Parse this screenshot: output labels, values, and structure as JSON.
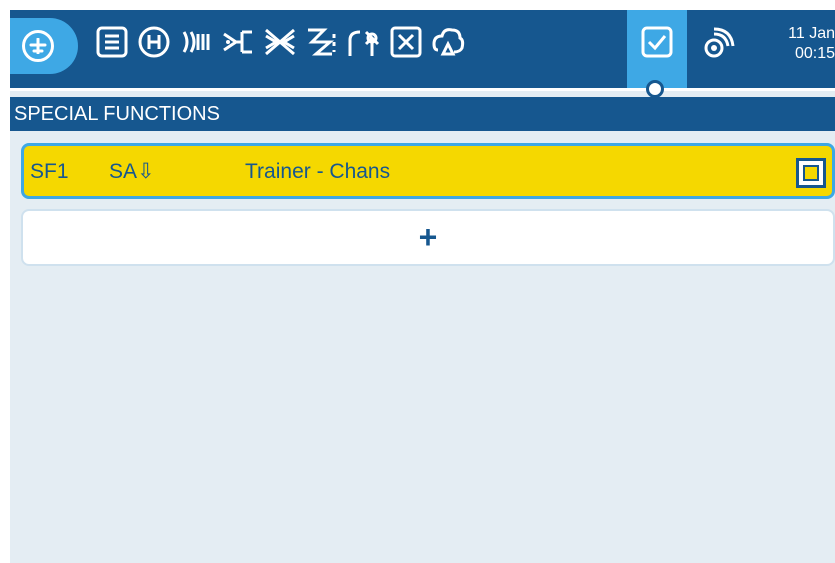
{
  "header": {
    "date": "11 Jan",
    "time": "00:15"
  },
  "tabs": [
    {
      "name": "model-setup-tab",
      "icon": "list-icon"
    },
    {
      "name": "heli-tab",
      "icon": "heli-icon"
    },
    {
      "name": "flight-modes-tab",
      "icon": "flight-modes-icon"
    },
    {
      "name": "inputs-tab",
      "icon": "inputs-icon"
    },
    {
      "name": "mixes-tab",
      "icon": "mixes-icon"
    },
    {
      "name": "outputs-tab",
      "icon": "outputs-icon"
    },
    {
      "name": "curves-tab",
      "icon": "curves-icon"
    },
    {
      "name": "global-vars-tab",
      "icon": "gvars-icon"
    },
    {
      "name": "logical-switches-tab",
      "icon": "logic-icon"
    },
    {
      "name": "special-functions-tab",
      "icon": "checkbox-icon"
    },
    {
      "name": "telemetry-tab",
      "icon": "telemetry-icon"
    }
  ],
  "section": {
    "title": "SPECIAL FUNCTIONS"
  },
  "functions": [
    {
      "id": "SF1",
      "switch": "SA⇩",
      "function": "Trainer - Chans",
      "enabled": false
    }
  ],
  "add_button": {
    "label": "+"
  },
  "colors": {
    "topbar": "#16578f",
    "accent": "#3ea8e5",
    "highlight": "#f5d800",
    "background": "#e4edf3"
  }
}
